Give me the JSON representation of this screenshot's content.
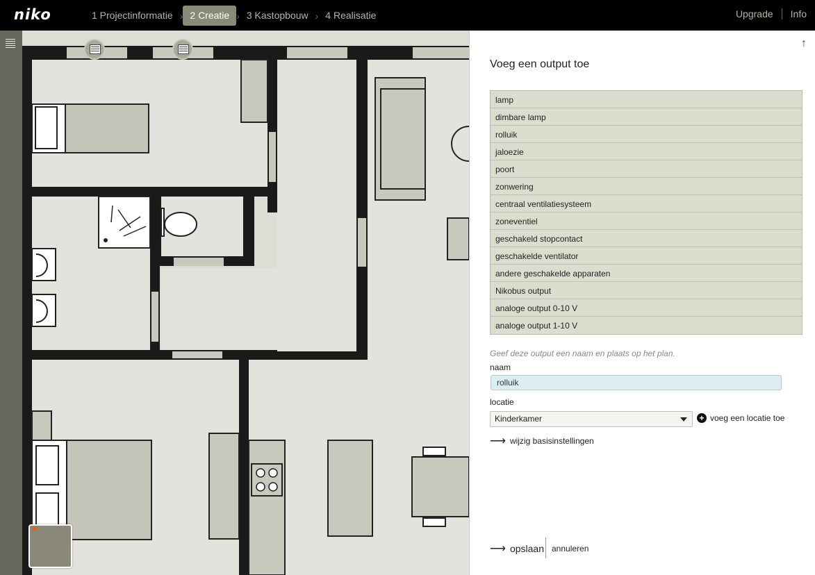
{
  "header": {
    "logo": "niko",
    "steps": [
      {
        "label": "1 Projectinformatie"
      },
      {
        "label": "2 Creatie"
      },
      {
        "label": "3 Kastopbouw"
      },
      {
        "label": "4 Realisatie"
      }
    ],
    "upgrade": "Upgrade",
    "info": "Info"
  },
  "panel": {
    "title": "Voeg een output toe",
    "outputs": [
      "lamp",
      "dimbare lamp",
      "rolluik",
      "jaloezie",
      "poort",
      "zonwering",
      "centraal ventilatiesysteem",
      "zoneventiel",
      "geschakeld stopcontact",
      "geschakelde ventilator",
      "andere geschakelde apparaten",
      "Nikobus output",
      "analoge output 0-10 V",
      "analoge output 1-10 V"
    ],
    "hint": "Geef deze output een naam en plaats op het plan.",
    "name_label": "naam",
    "name_value": "rolluik",
    "location_label": "locatie",
    "location_value": "Kinderkamer",
    "add_location": "voeg een locatie toe",
    "settings_link": "wijzig basisinstellingen",
    "save": "opslaan",
    "cancel": "annuleren"
  },
  "colors": {
    "topbar": "#000000",
    "active_step": "#8a8a78",
    "rail": "#66665a",
    "list_bg": "#dcdccf",
    "input_bg": "#dceef3"
  }
}
